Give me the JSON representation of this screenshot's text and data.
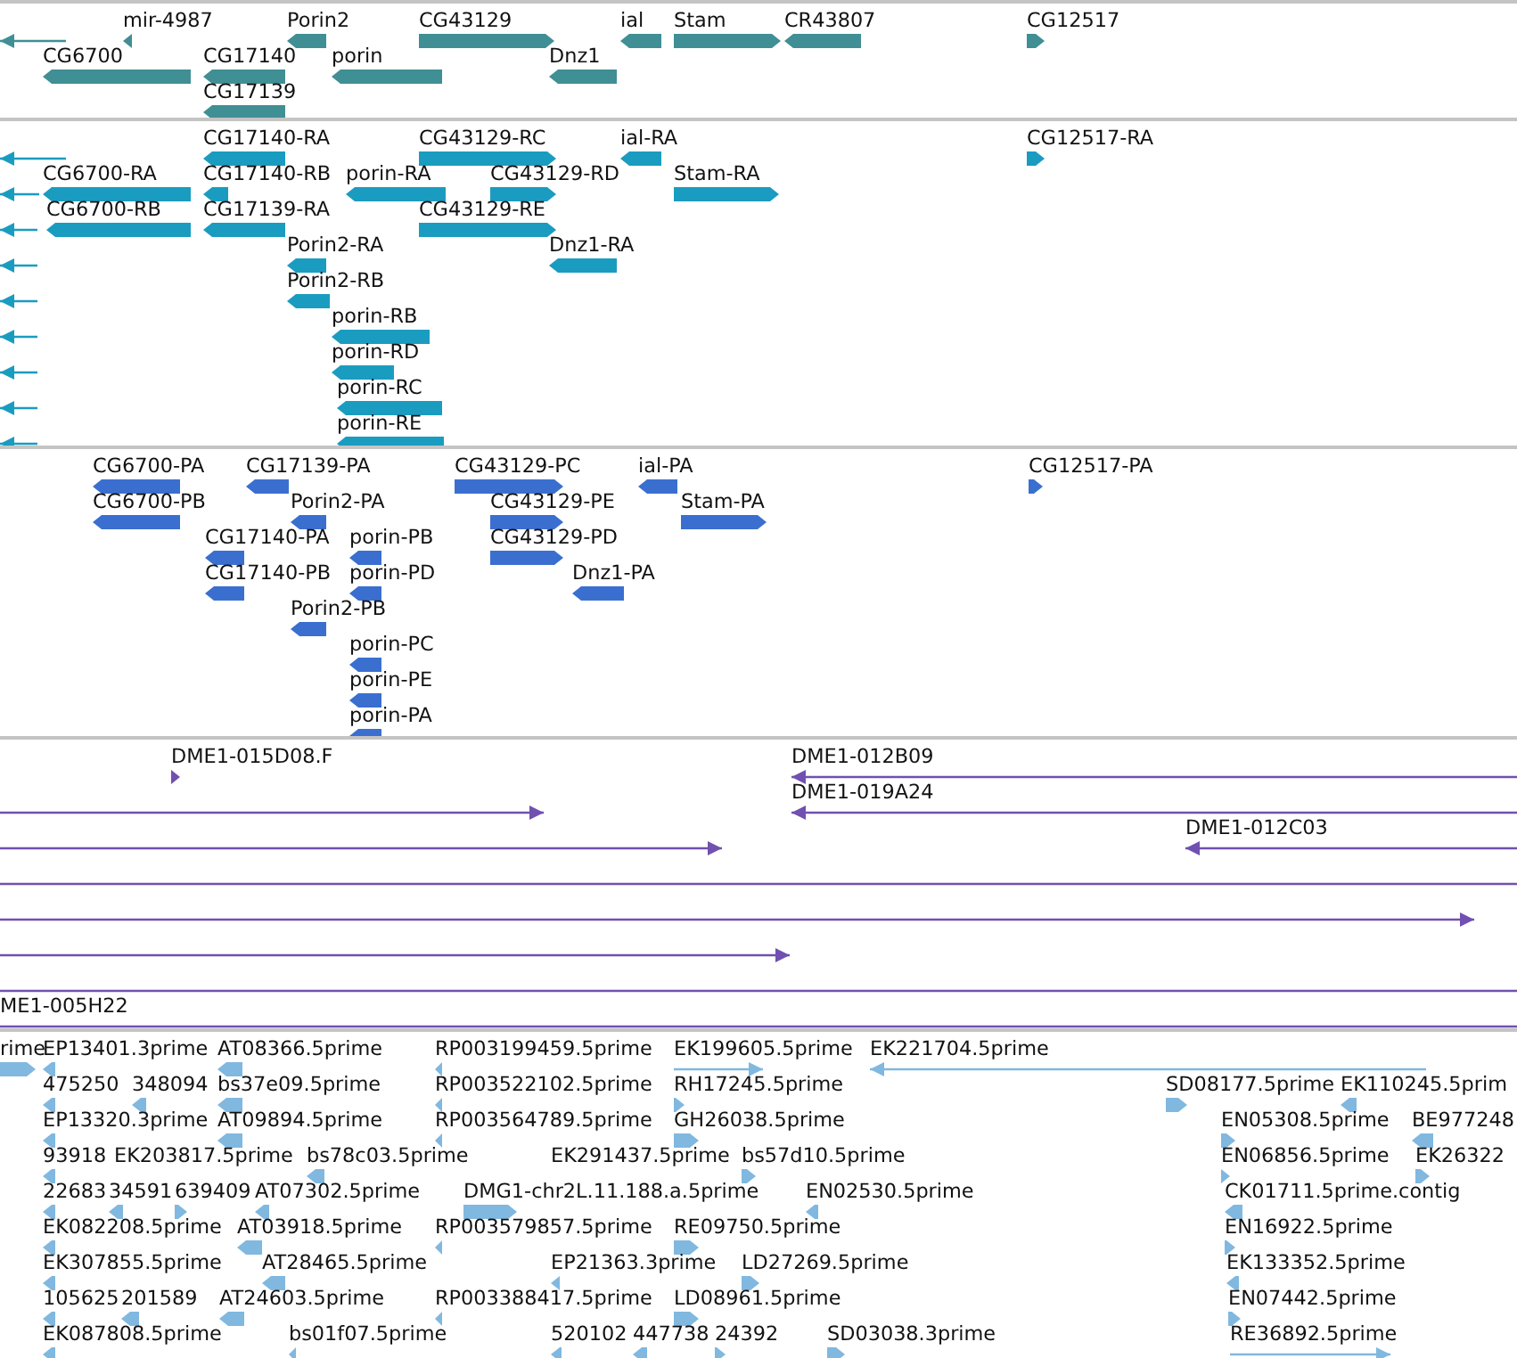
{
  "tracks": [
    {
      "lanes": [
        {
          "features": [
            {
              "reverse": true
            },
            {
              "label": "mir-4987",
              "reverse": true
            },
            {
              "label": "Porin2",
              "reverse": true
            },
            {
              "label": "CG43129",
              "reverse": false
            },
            {
              "label": "ial",
              "reverse": true
            },
            {
              "label": "Stam",
              "reverse": false
            },
            {
              "label": "CR43807",
              "reverse": true
            },
            {
              "label": "CG12517",
              "reverse": false
            }
          ]
        },
        {
          "features": [
            {
              "label": "CG6700",
              "reverse": true
            },
            {
              "label": "CG17140",
              "reverse": true
            },
            {
              "label": "porin",
              "reverse": true
            },
            {
              "label": "Dnz1",
              "reverse": true
            }
          ]
        },
        {
          "features": [
            {
              "label": "CG17139",
              "reverse": true
            }
          ]
        }
      ]
    },
    {
      "lanes": [
        {
          "features": [
            {
              "reverse": true
            },
            {
              "label": "CG17140-RA",
              "reverse": true
            },
            {
              "label": "CG43129-RC",
              "reverse": false
            },
            {
              "label": "ial-RA",
              "reverse": true
            },
            {
              "label": "CG12517-RA",
              "reverse": false
            }
          ]
        },
        {
          "features": [
            {
              "reverse": true
            },
            {
              "label": "CG6700-RA",
              "reverse": true
            },
            {
              "label": "CG17140-RB",
              "reverse": true
            },
            {
              "label": "porin-RA",
              "reverse": true
            },
            {
              "label": "CG43129-RD",
              "reverse": false
            },
            {
              "label": "Stam-RA",
              "reverse": false
            }
          ]
        },
        {
          "features": [
            {
              "reverse": true
            },
            {
              "label": "CG6700-RB",
              "reverse": true
            },
            {
              "label": "CG17139-RA",
              "reverse": true
            },
            {
              "label": "CG43129-RE",
              "reverse": false
            }
          ]
        },
        {
          "features": [
            {
              "reverse": true
            },
            {
              "label": "Porin2-RA",
              "reverse": true
            },
            {
              "label": "Dnz1-RA",
              "reverse": true
            }
          ]
        },
        {
          "features": [
            {
              "reverse": true
            },
            {
              "label": "Porin2-RB",
              "reverse": true
            }
          ]
        },
        {
          "features": [
            {
              "reverse": true
            },
            {
              "label": "porin-RB",
              "reverse": true
            }
          ]
        },
        {
          "features": [
            {
              "reverse": true
            },
            {
              "label": "porin-RD",
              "reverse": true
            }
          ]
        },
        {
          "features": [
            {
              "reverse": true
            },
            {
              "label": "porin-RC",
              "reverse": true
            }
          ]
        },
        {
          "features": [
            {
              "reverse": true
            },
            {
              "label": "porin-RE",
              "reverse": true
            }
          ]
        }
      ]
    },
    {
      "lanes": [
        {
          "features": [
            {
              "label": "CG6700-PA",
              "reverse": true
            },
            {
              "label": "CG17139-PA",
              "reverse": true
            },
            {
              "label": "CG43129-PC",
              "reverse": false
            },
            {
              "label": "ial-PA",
              "reverse": true
            },
            {
              "label": "CG12517-PA",
              "reverse": false
            }
          ]
        },
        {
          "features": [
            {
              "label": "CG6700-PB",
              "reverse": true
            },
            {
              "label": "Porin2-PA",
              "reverse": true
            },
            {
              "label": "CG43129-PE",
              "reverse": false
            },
            {
              "label": "Stam-PA",
              "reverse": false
            }
          ]
        },
        {
          "features": [
            {
              "label": "CG17140-PA",
              "reverse": true
            },
            {
              "label": "porin-PB",
              "reverse": true
            },
            {
              "label": "CG43129-PD",
              "reverse": false
            }
          ]
        },
        {
          "features": [
            {
              "label": "CG17140-PB",
              "reverse": true
            },
            {
              "label": "porin-PD",
              "reverse": true
            },
            {
              "label": "Dnz1-PA",
              "reverse": true
            }
          ]
        },
        {
          "features": [
            {
              "label": "Porin2-PB",
              "reverse": true
            }
          ]
        },
        {
          "features": [
            {
              "label": "porin-PC",
              "reverse": true
            }
          ]
        },
        {
          "features": [
            {
              "label": "porin-PE",
              "reverse": true
            }
          ]
        },
        {
          "features": [
            {
              "label": "porin-PA",
              "reverse": true
            }
          ]
        }
      ]
    },
    {
      "lanes": [
        {
          "features": [
            {
              "label": "DME1-015D08.F",
              "reverse": false
            },
            {
              "label": "DME1-012B09",
              "reverse": true
            }
          ]
        },
        {
          "features": [
            {
              "reverse": false
            },
            {
              "label": "DME1-019A24",
              "reverse": true
            }
          ]
        },
        {
          "features": [
            {
              "reverse": false
            },
            {
              "label": "DME1-012C03",
              "reverse": true
            }
          ]
        },
        {
          "features": [
            {
              "kind": "line"
            }
          ]
        },
        {
          "features": [
            {
              "reverse": false
            }
          ]
        },
        {
          "features": [
            {
              "reverse": false
            }
          ]
        },
        {
          "features": [
            {
              "kind": "line"
            }
          ]
        },
        {
          "features": [
            {
              "label": "ME1-005H22"
            }
          ]
        }
      ]
    },
    {
      "lanes": [
        {
          "features": [
            {
              "label": "rime",
              "reverse": false
            },
            {
              "label": "EP13401.3prime",
              "reverse": true
            },
            {
              "label": "AT08366.5prime",
              "reverse": true
            },
            {
              "label": "RP003199459.5prime",
              "reverse": true
            },
            {
              "label": "EK199605.5prime",
              "reverse": false
            },
            {
              "label": "EK221704.5prime",
              "reverse": true
            }
          ]
        },
        {
          "features": [
            {
              "label": "475250",
              "reverse": true
            },
            {
              "label": "348094",
              "reverse": true
            },
            {
              "label": "bs37e09.5prime",
              "reverse": true
            },
            {
              "label": "RP003522102.5prime",
              "reverse": true
            },
            {
              "label": "RH17245.5prime",
              "reverse": false
            },
            {
              "label": "SD08177.5prime",
              "reverse": false
            },
            {
              "label": "EK110245.5prim",
              "reverse": true
            }
          ]
        },
        {
          "features": [
            {
              "label": "EP13320.3prime",
              "reverse": true
            },
            {
              "label": "AT09894.5prime",
              "reverse": true
            },
            {
              "label": "RP003564789.5prime",
              "reverse": true
            },
            {
              "label": "GH26038.5prime",
              "reverse": false
            },
            {
              "label": "EN05308.5prime",
              "reverse": false
            },
            {
              "label": "BE977248",
              "reverse": true
            }
          ]
        },
        {
          "features": [
            {
              "label": "93918",
              "reverse": true
            },
            {
              "label": "EK203817.5prime"
            },
            {
              "label": "bs78c03.5prime",
              "reverse": true
            },
            {
              "label": "EK291437.5prime"
            },
            {
              "label": "bs57d10.5prime",
              "reverse": false
            },
            {
              "label": "EN06856.5prime",
              "reverse": false
            },
            {
              "label": "EK26322",
              "reverse": false
            }
          ]
        },
        {
          "features": [
            {
              "label": "22683",
              "reverse": true
            },
            {
              "label": "34591",
              "reverse": true
            },
            {
              "label": "639409",
              "reverse": false
            },
            {
              "label": "AT07302.5prime",
              "reverse": true
            },
            {
              "label": "DMG1-chr2L.11.188.a.5prime",
              "reverse": false
            },
            {
              "label": "EN02530.5prime",
              "reverse": true
            },
            {
              "label": "CK01711.5prime.contig",
              "reverse": true
            }
          ]
        },
        {
          "features": [
            {
              "label": "EK082208.5prime",
              "reverse": true
            },
            {
              "label": "AT03918.5prime",
              "reverse": true
            },
            {
              "label": "RP003579857.5prime",
              "reverse": true
            },
            {
              "label": "RE09750.5prime",
              "reverse": false
            },
            {
              "label": "EN16922.5prime",
              "reverse": false
            }
          ]
        },
        {
          "features": [
            {
              "label": "EK307855.5prime",
              "reverse": true
            },
            {
              "label": "AT28465.5prime",
              "reverse": true
            },
            {
              "label": "EP21363.3prime",
              "reverse": true
            },
            {
              "label": "LD27269.5prime",
              "reverse": false
            },
            {
              "label": "EK133352.5prime",
              "reverse": true
            }
          ]
        },
        {
          "features": [
            {
              "label": "105625",
              "reverse": true
            },
            {
              "label": "201589",
              "reverse": true
            },
            {
              "label": "AT24603.5prime",
              "reverse": true
            },
            {
              "label": "RP003388417.5prime",
              "reverse": true
            },
            {
              "label": "LD08961.5prime",
              "reverse": false
            },
            {
              "label": "EN07442.5prime",
              "reverse": false
            }
          ]
        },
        {
          "features": [
            {
              "label": "EK087808.5prime",
              "reverse": true
            },
            {
              "label": "bs01f07.5prime",
              "reverse": true
            },
            {
              "label": "520102",
              "reverse": true
            },
            {
              "label": "447738",
              "reverse": true
            },
            {
              "label": "24392",
              "reverse": false
            },
            {
              "label": "SD03038.3prime",
              "reverse": false
            },
            {
              "label": "RE36892.5prime",
              "reverse": false
            }
          ]
        }
      ]
    }
  ]
}
